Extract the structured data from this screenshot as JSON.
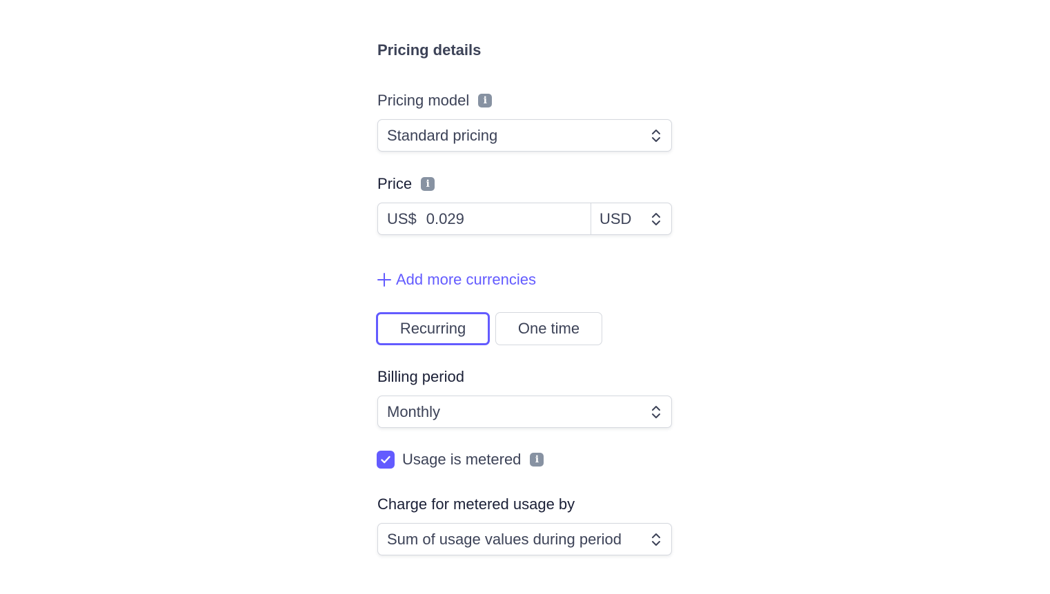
{
  "section": {
    "title": "Pricing details"
  },
  "pricing_model": {
    "label": "Pricing model",
    "info_icon": "info-icon",
    "value": "Standard pricing"
  },
  "price": {
    "label": "Price",
    "info_icon": "info-icon",
    "prefix": "US$",
    "amount": "0.029",
    "currency": "USD"
  },
  "add_currencies": {
    "label": "Add more currencies",
    "icon": "plus-icon"
  },
  "billing_type": {
    "options": [
      "Recurring",
      "One time"
    ],
    "selected": "Recurring"
  },
  "billing_period": {
    "label": "Billing period",
    "value": "Monthly"
  },
  "metered": {
    "label": "Usage is metered",
    "checked": true,
    "info_icon": "info-icon"
  },
  "charge_by": {
    "label": "Charge for metered usage by",
    "value": "Sum of usage values during period"
  },
  "colors": {
    "accent": "#635bff",
    "text": "#3c4257",
    "text_dark": "#1a1f36",
    "border": "#d5d8de",
    "icon_gray": "#8792a2"
  }
}
